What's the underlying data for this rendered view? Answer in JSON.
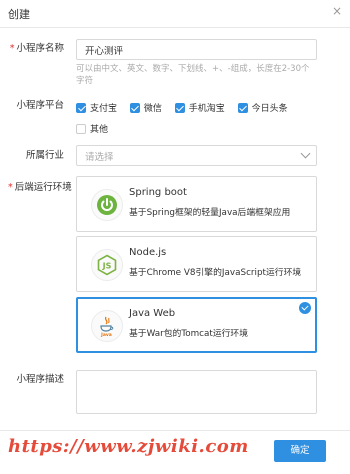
{
  "dialog": {
    "title": "创建",
    "close_glyph": "×"
  },
  "form": {
    "name_label": "小程序名称",
    "name_value": "开心测评",
    "name_hint": "可以由中文、英文、数字、下划线、+、-组成，长度在2-30个字符",
    "platform_label": "小程序平台",
    "platforms": [
      {
        "label": "支付宝",
        "checked": true
      },
      {
        "label": "微信",
        "checked": true
      },
      {
        "label": "手机淘宝",
        "checked": true
      },
      {
        "label": "今日头条",
        "checked": true
      },
      {
        "label": "其他",
        "checked": false
      }
    ],
    "industry_label": "所属行业",
    "industry_placeholder": "请选择",
    "backend_label": "后端运行环境",
    "backends": [
      {
        "name": "Spring boot",
        "desc": "基于Spring框架的轻量Java后端框架应用",
        "selected": false,
        "icon": "spring-power-icon"
      },
      {
        "name": "Node.js",
        "desc": "基于Chrome V8引擎的JavaScript运行环境",
        "selected": false,
        "icon": "nodejs-hexagon-icon"
      },
      {
        "name": "Java Web",
        "desc": "基于War包的Tomcat运行环境",
        "selected": true,
        "icon": "java-cup-icon"
      }
    ],
    "desc_label": "小程序描述"
  },
  "footer": {
    "ok_label": "确定"
  },
  "watermark": "https://www.zjwiki.com",
  "colors": {
    "accent": "#2f8fe0",
    "required": "#e03030",
    "watermark": "#e23c2a"
  }
}
